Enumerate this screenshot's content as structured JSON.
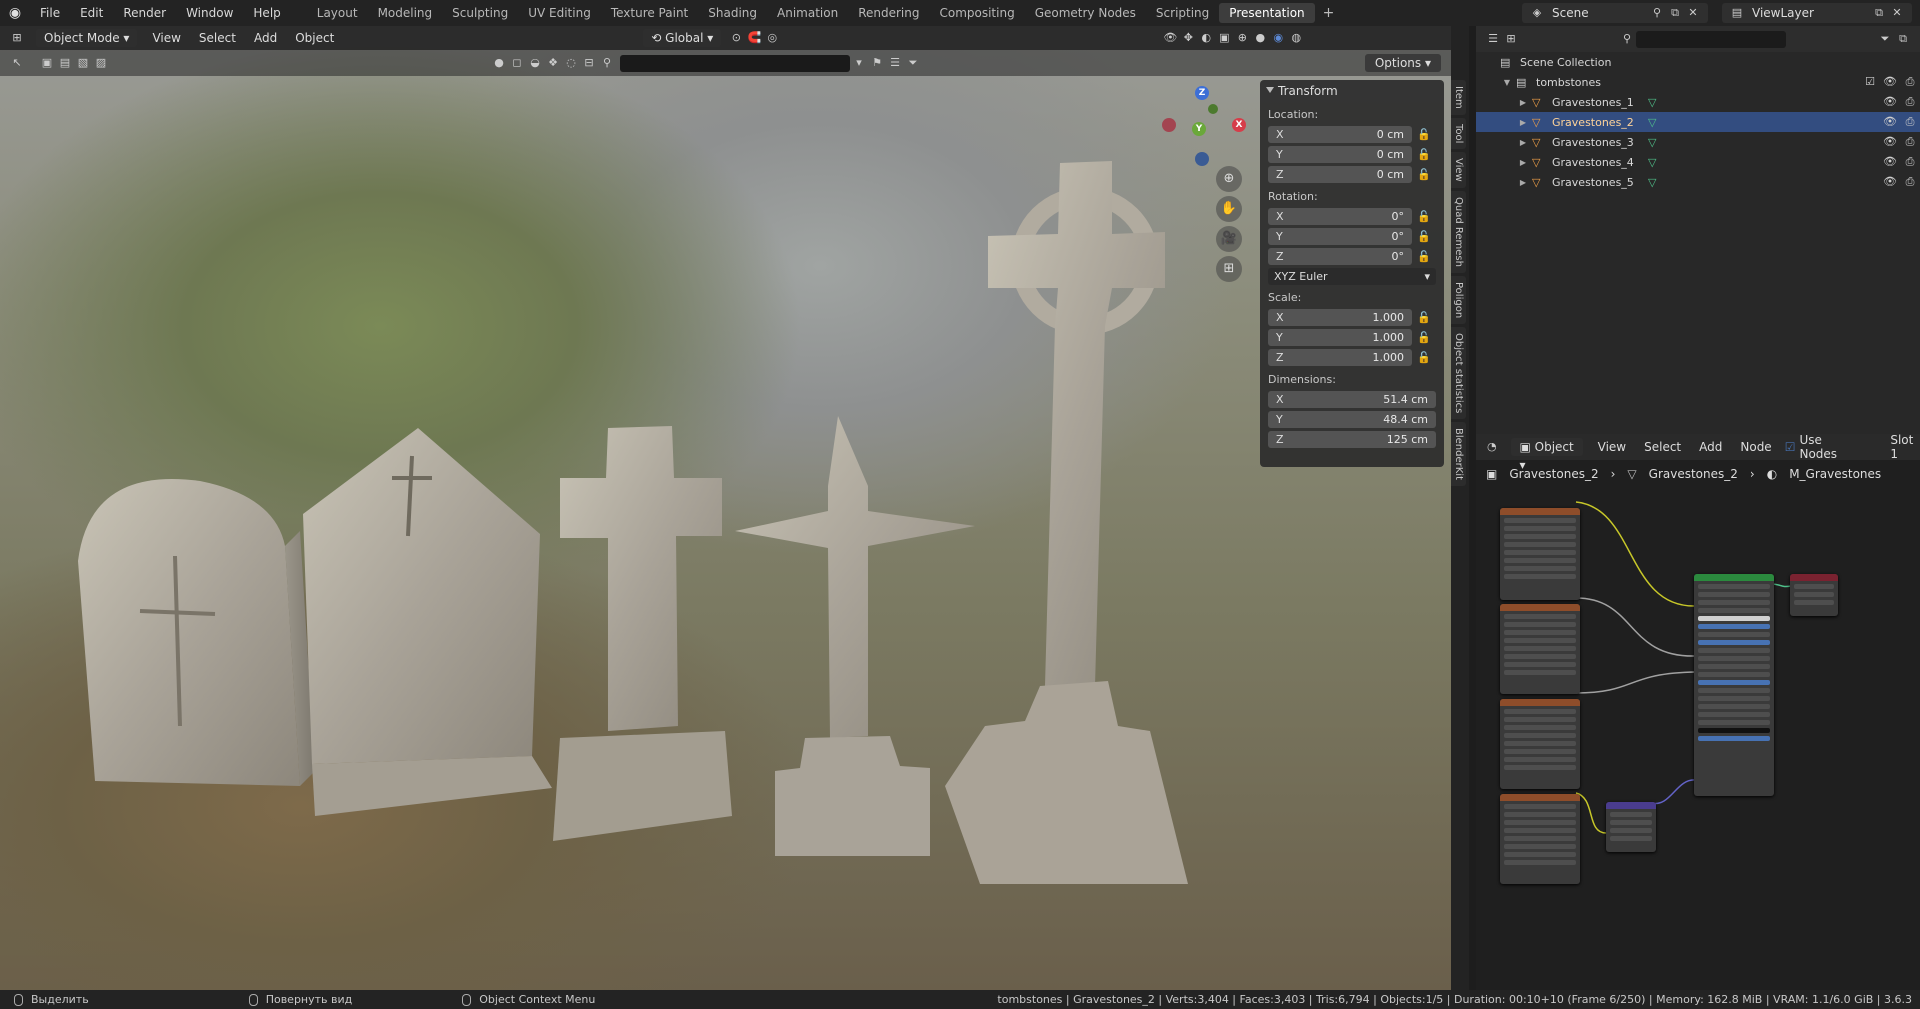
{
  "top_menu": [
    "File",
    "Edit",
    "Render",
    "Window",
    "Help"
  ],
  "workspaces": [
    "Layout",
    "Modeling",
    "Sculpting",
    "UV Editing",
    "Texture Paint",
    "Shading",
    "Animation",
    "Rendering",
    "Compositing",
    "Geometry Nodes",
    "Scripting",
    "Presentation"
  ],
  "active_workspace": "Presentation",
  "scene_name": "Scene",
  "view_layer": "ViewLayer",
  "viewport": {
    "mode": "Object Mode",
    "menus": [
      "View",
      "Select",
      "Add",
      "Object"
    ],
    "transform_orientation": "Global",
    "options_label": "Options",
    "gizmo_axes": {
      "x": "X",
      "y": "Y",
      "z": "Z"
    }
  },
  "npanel": {
    "title": "Transform",
    "location_label": "Location:",
    "location": [
      {
        "axis": "X",
        "value": "0 cm"
      },
      {
        "axis": "Y",
        "value": "0 cm"
      },
      {
        "axis": "Z",
        "value": "0 cm"
      }
    ],
    "rotation_label": "Rotation:",
    "rotation": [
      {
        "axis": "X",
        "value": "0°"
      },
      {
        "axis": "Y",
        "value": "0°"
      },
      {
        "axis": "Z",
        "value": "0°"
      }
    ],
    "rotation_mode": "XYZ Euler",
    "scale_label": "Scale:",
    "scale": [
      {
        "axis": "X",
        "value": "1.000"
      },
      {
        "axis": "Y",
        "value": "1.000"
      },
      {
        "axis": "Z",
        "value": "1.000"
      }
    ],
    "dimensions_label": "Dimensions:",
    "dimensions": [
      {
        "axis": "X",
        "value": "51.4 cm"
      },
      {
        "axis": "Y",
        "value": "48.4 cm"
      },
      {
        "axis": "Z",
        "value": "125 cm"
      }
    ],
    "side_tabs": [
      "Item",
      "Tool",
      "View",
      "Quad Remesh",
      "Poligon",
      "Object statistics",
      "BlenderKit"
    ]
  },
  "outliner": {
    "root": "Scene Collection",
    "collection": "tombstones",
    "objects": [
      "Gravestones_1",
      "Gravestones_2",
      "Gravestones_3",
      "Gravestones_4",
      "Gravestones_5"
    ],
    "selected": "Gravestones_2"
  },
  "node_editor": {
    "object_menu": "Object",
    "menus": [
      "View",
      "Select",
      "Add",
      "Node"
    ],
    "use_nodes_label": "Use Nodes",
    "slot_label": "Slot 1",
    "breadcrumb": [
      "Gravestones_2",
      "Gravestones_2",
      "M_Gravestones"
    ]
  },
  "statusbar": {
    "hints": [
      "Выделить",
      "Повернуть вид",
      "Object Context Menu"
    ],
    "stats": "tombstones | Gravestones_2 | Verts:3,404 | Faces:3,403 | Tris:6,794 | Objects:1/5 | Duration: 00:10+10 (Frame 6/250) | Memory: 162.8 MiB | VRAM: 1.1/6.0 GiB | 3.6.3"
  },
  "colors": {
    "selection": "#334d80",
    "selected_text": "#ffd49a",
    "accent": "#4772b3"
  }
}
